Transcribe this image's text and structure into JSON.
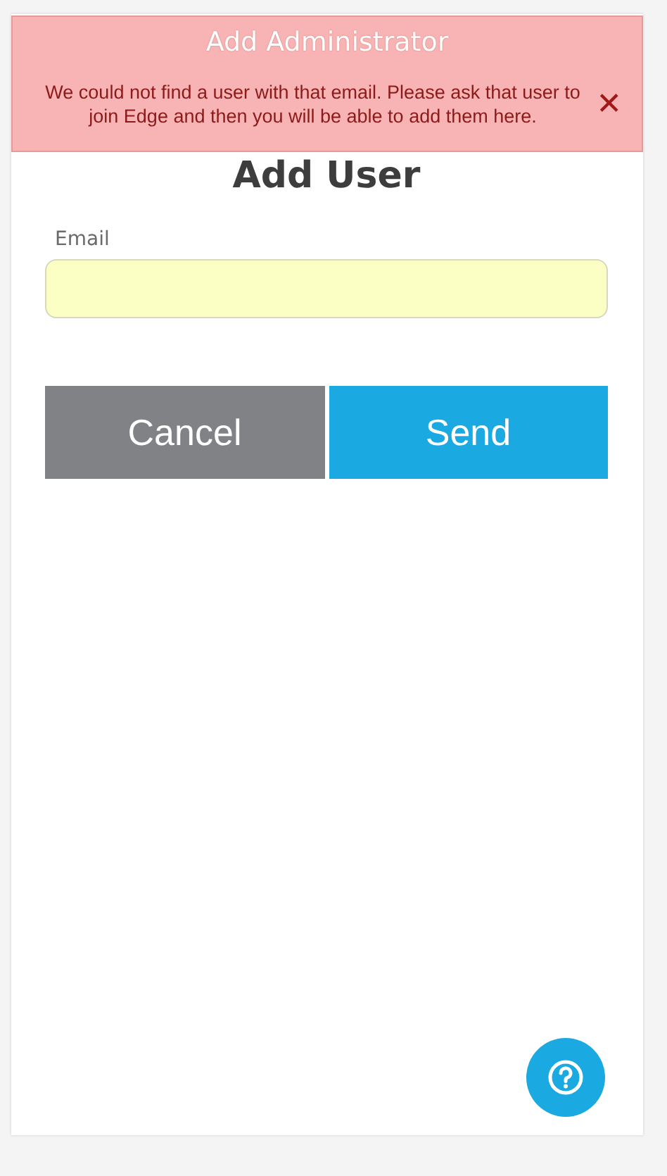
{
  "header": {
    "title": "Add Administrator"
  },
  "alert": {
    "message": "We could not find a user with that email. Please ask that user to join Edge and then you will be able to add them here.",
    "close": "✕"
  },
  "form": {
    "title": "Add User",
    "email": {
      "label": "Email"
    }
  },
  "buttons": [
    {
      "label": "Cancel",
      "kind": "secondary"
    },
    {
      "label": "Send",
      "kind": "primary"
    }
  ]
}
